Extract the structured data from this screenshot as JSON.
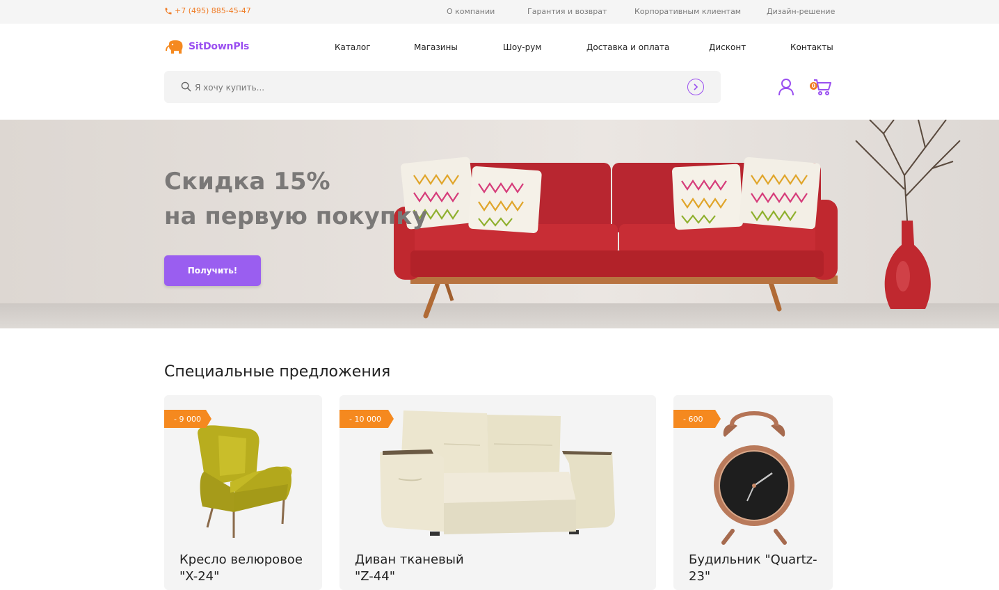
{
  "topbar": {
    "phone": "+7 (495) 885-45-47",
    "links": [
      "О компании",
      "Гарантия и возврат",
      "Корпоративным клиентам",
      "Дизайн-решение"
    ]
  },
  "header": {
    "logo_text": "SitDownPls",
    "nav": [
      "Каталог",
      "Магазины",
      "Шоу-рум",
      "Доставка и оплата",
      "Дисконт",
      "Контакты"
    ],
    "search_placeholder": "Я хочу купить...",
    "cart_count": "0"
  },
  "hero": {
    "title_line1": "Скидка 15%",
    "title_line2": "на первую покупку",
    "button_label": "Получить!"
  },
  "special": {
    "title": "Специальные предложения",
    "items": [
      {
        "discount": "- 9 000",
        "name_line1": "Кресло велюровое",
        "name_line2": "\"X-24\""
      },
      {
        "discount": "- 10 000",
        "name_line1": "Диван тканевый",
        "name_line2": "\"Z-44\""
      },
      {
        "discount": "- 600",
        "name_line1": "Будильник \"Quartz-",
        "name_line2": "23\""
      }
    ]
  },
  "colors": {
    "accent": "#9a4ff0",
    "orange": "#f07b24",
    "sofa_red": "#c0282f"
  }
}
